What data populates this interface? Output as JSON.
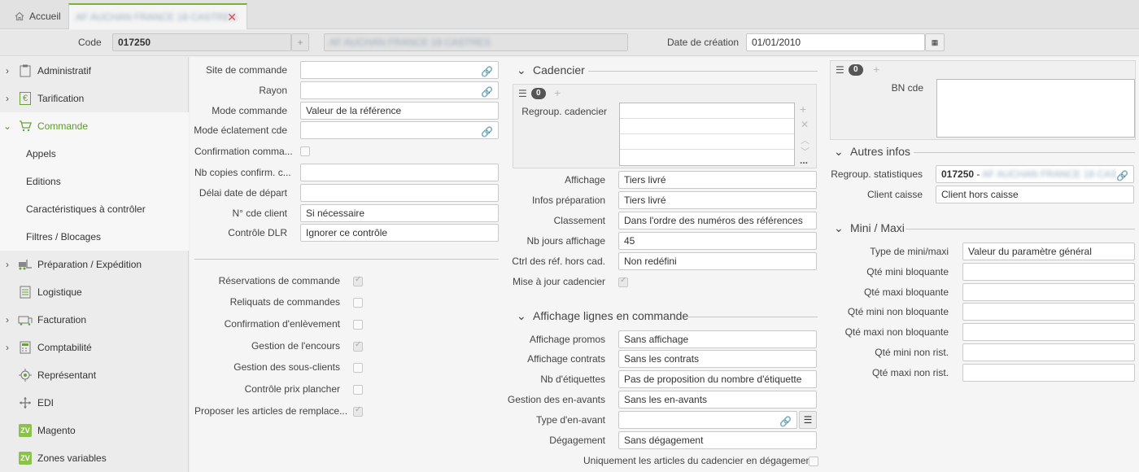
{
  "tabs": {
    "home_label": "Accueil",
    "client_label": "AF AUCHAN FRANCE 18 CASTRES"
  },
  "header": {
    "code_label": "Code",
    "code_value": "017250",
    "name_value": "AF AUCHAN FRANCE 18 CASTRES",
    "creation_label": "Date de création",
    "creation_value": "01/01/2010"
  },
  "sidebar": {
    "items": [
      {
        "label": "Administratif"
      },
      {
        "label": "Tarification"
      },
      {
        "label": "Commande"
      },
      {
        "label": "Appels"
      },
      {
        "label": "Editions"
      },
      {
        "label": "Caractéristiques à contrôler"
      },
      {
        "label": "Filtres / Blocages"
      },
      {
        "label": "Préparation / Expédition"
      },
      {
        "label": "Logistique"
      },
      {
        "label": "Facturation"
      },
      {
        "label": "Comptabilité"
      },
      {
        "label": "Représentant"
      },
      {
        "label": "EDI"
      },
      {
        "label": "Magento"
      },
      {
        "label": "Zones variables"
      }
    ],
    "zv_text": "ZV"
  },
  "col1": {
    "fields": [
      {
        "label": "Site de commande",
        "value": ""
      },
      {
        "label": "Rayon",
        "value": ""
      },
      {
        "label": "Mode commande",
        "value": "Valeur de la référence"
      },
      {
        "label": "Mode éclatement cde",
        "value": ""
      },
      {
        "label": "Confirmation comma...",
        "value": ""
      },
      {
        "label": "Nb copies confirm. c...",
        "value": ""
      },
      {
        "label": "Délai date de départ",
        "value": ""
      },
      {
        "label": "N° cde client",
        "value": "Si nécessaire"
      },
      {
        "label": "Contrôle DLR",
        "value": "Ignorer ce contrôle"
      }
    ],
    "checks": [
      {
        "label": "Réservations de commande",
        "checked": true
      },
      {
        "label": "Reliquats de commandes",
        "checked": false
      },
      {
        "label": "Confirmation d'enlèvement",
        "checked": false
      },
      {
        "label": "Gestion de l'encours",
        "checked": true
      },
      {
        "label": "Gestion des sous-clients",
        "checked": false
      },
      {
        "label": "Contrôle prix plancher",
        "checked": false
      },
      {
        "label": "Proposer les articles de remplace...",
        "checked": true
      }
    ]
  },
  "cadencier": {
    "title": "Cadencier",
    "badge": "0",
    "regroup_label": "Regroup. cadencier",
    "more": "...",
    "fields": [
      {
        "label": "Affichage",
        "value": "Tiers livré"
      },
      {
        "label": "Infos préparation",
        "value": "Tiers livré"
      },
      {
        "label": "Classement",
        "value": "Dans l'ordre des numéros des références"
      },
      {
        "label": "Nb jours affichage",
        "value": "45"
      },
      {
        "label": "Ctrl des réf. hors cad.",
        "value": "Non redéfini"
      }
    ],
    "maj_label": "Mise à jour cadencier"
  },
  "affichage": {
    "title": "Affichage lignes en commande",
    "fields": [
      {
        "label": "Affichage promos",
        "value": "Sans affichage"
      },
      {
        "label": "Affichage contrats",
        "value": "Sans les contrats"
      },
      {
        "label": "Nb d'étiquettes",
        "value": "Pas de proposition du nombre d'étiquette"
      },
      {
        "label": "Gestion des en-avants",
        "value": "Sans les en-avants"
      },
      {
        "label": "Type d'en-avant",
        "value": ""
      },
      {
        "label": "Dégagement",
        "value": "Sans dégagement"
      }
    ],
    "uniquement_label": "Uniquement les articles du cadencier en dégagement"
  },
  "right": {
    "badge": "0",
    "bn_label": "BN cde",
    "autres_title": "Autres infos",
    "regroup_label": "Regroup. statistiques",
    "regroup_code": "017250",
    "regroup_sep": " - ",
    "regroup_name": "AF AUCHAN FRANCE 18 CAST",
    "client_caisse_label": "Client caisse",
    "client_caisse_value": "Client hors caisse",
    "minimaxi_title": "Mini / Maxi",
    "mm_fields": [
      {
        "label": "Type de mini/maxi",
        "value": "Valeur du paramètre général"
      },
      {
        "label": "Qté mini bloquante",
        "value": ""
      },
      {
        "label": "Qté maxi bloquante",
        "value": ""
      },
      {
        "label": "Qté mini non bloquante",
        "value": ""
      },
      {
        "label": "Qté maxi non bloquante",
        "value": ""
      },
      {
        "label": "Qté mini non rist.",
        "value": ""
      },
      {
        "label": "Qté maxi non rist.",
        "value": ""
      }
    ]
  },
  "colors": {
    "accent": "#7bb03a",
    "active_text": "#5a9a2a",
    "close": "#e05050"
  }
}
